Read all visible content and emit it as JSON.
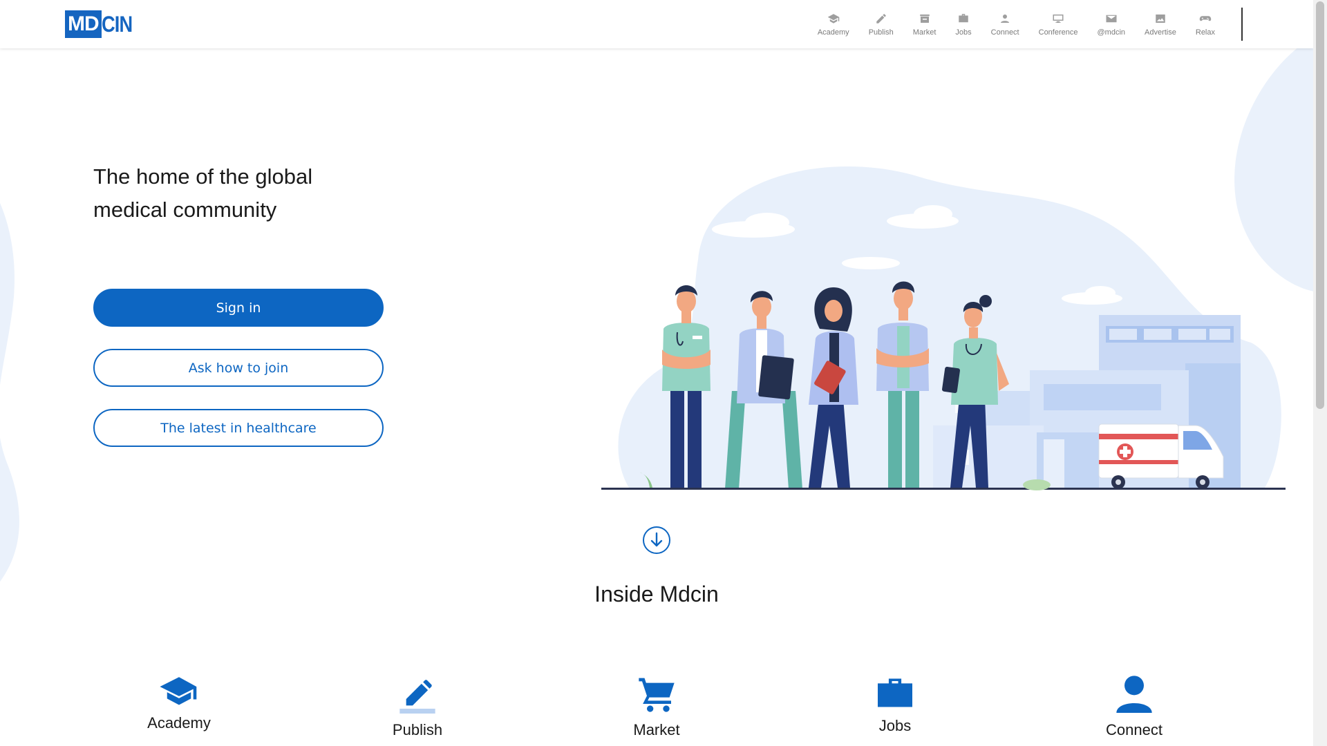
{
  "brand": {
    "logo_left": "MD",
    "logo_right": "CIN"
  },
  "nav": [
    {
      "label": "Academy",
      "icon": "graduation-cap-icon"
    },
    {
      "label": "Publish",
      "icon": "pencil-icon"
    },
    {
      "label": "Market",
      "icon": "store-icon"
    },
    {
      "label": "Jobs",
      "icon": "briefcase-icon"
    },
    {
      "label": "Connect",
      "icon": "person-icon"
    },
    {
      "label": "Conference",
      "icon": "monitor-icon"
    },
    {
      "label": "@mdcin",
      "icon": "envelope-icon"
    },
    {
      "label": "Advertise",
      "icon": "image-ad-icon"
    },
    {
      "label": "Relax",
      "icon": "gamepad-icon"
    }
  ],
  "hero": {
    "title_line1": "The home of the global",
    "title_line2": "medical community",
    "sign_in": "Sign in",
    "ask_join": "Ask how to join",
    "latest": "The latest in healthcare"
  },
  "inside": {
    "title": "Inside Mdcin"
  },
  "features": [
    {
      "label": "Academy",
      "icon": "graduation-cap-icon"
    },
    {
      "label": "Publish",
      "icon": "pencil-icon"
    },
    {
      "label": "Market",
      "icon": "cart-icon"
    },
    {
      "label": "Jobs",
      "icon": "briefcase-icon"
    },
    {
      "label": "Connect",
      "icon": "person-icon"
    }
  ],
  "colors": {
    "primary": "#0d66c2",
    "blob": "#eaf1fb",
    "nav_icon": "#9e9e9e"
  }
}
